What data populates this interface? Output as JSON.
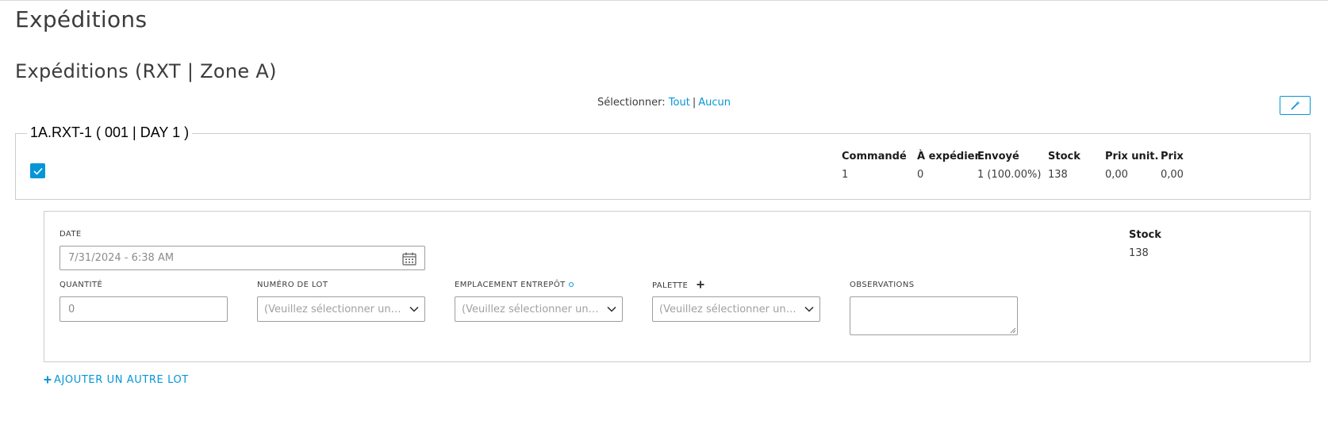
{
  "page": {
    "title": "Expéditions"
  },
  "section": {
    "title": "Expéditions (RXT | Zone A)"
  },
  "selection": {
    "label": "Sélectionner:",
    "all": "Tout",
    "separator": "|",
    "none": "Aucun"
  },
  "toolbar": {
    "wand_icon": "magic-wand-icon"
  },
  "item": {
    "title": "1A.RXT-1 ( 001 | DAY 1 )",
    "checked": true,
    "columns": [
      {
        "header": "Commandé",
        "value": "1"
      },
      {
        "header": "À expédier",
        "value": "0"
      },
      {
        "header": "Envoyé",
        "value": "1 (100.00%)"
      },
      {
        "header": "Stock",
        "value": "138"
      },
      {
        "header": "Prix unit.",
        "value": "0,00"
      },
      {
        "header": "Prix",
        "value": "0,00"
      }
    ]
  },
  "lot": {
    "date": {
      "label": "DATE",
      "value": "7/31/2024 - 6:38 AM",
      "icon": "calendar-icon"
    },
    "quantity": {
      "label": "QUANTITÉ",
      "placeholder": "0"
    },
    "lot_number": {
      "label": "NUMÉRO DE LOT",
      "placeholder": "(Veuillez sélectionner une option)"
    },
    "warehouse": {
      "label": "EMPLACEMENT ENTREPÔT",
      "placeholder": "(Veuillez sélectionner une option)"
    },
    "pallet": {
      "label": "PALETTE",
      "placeholder": "(Veuillez sélectionner une option)"
    },
    "notes": {
      "label": "OBSERVATIONS"
    },
    "stock": {
      "label": "Stock",
      "value": "138"
    }
  },
  "add_lot": {
    "label": "AJOUTER UN AUTRE LOT"
  },
  "colors": {
    "accent": "#0696d7",
    "border": "#cccccc",
    "text": "#3c3c3c"
  }
}
